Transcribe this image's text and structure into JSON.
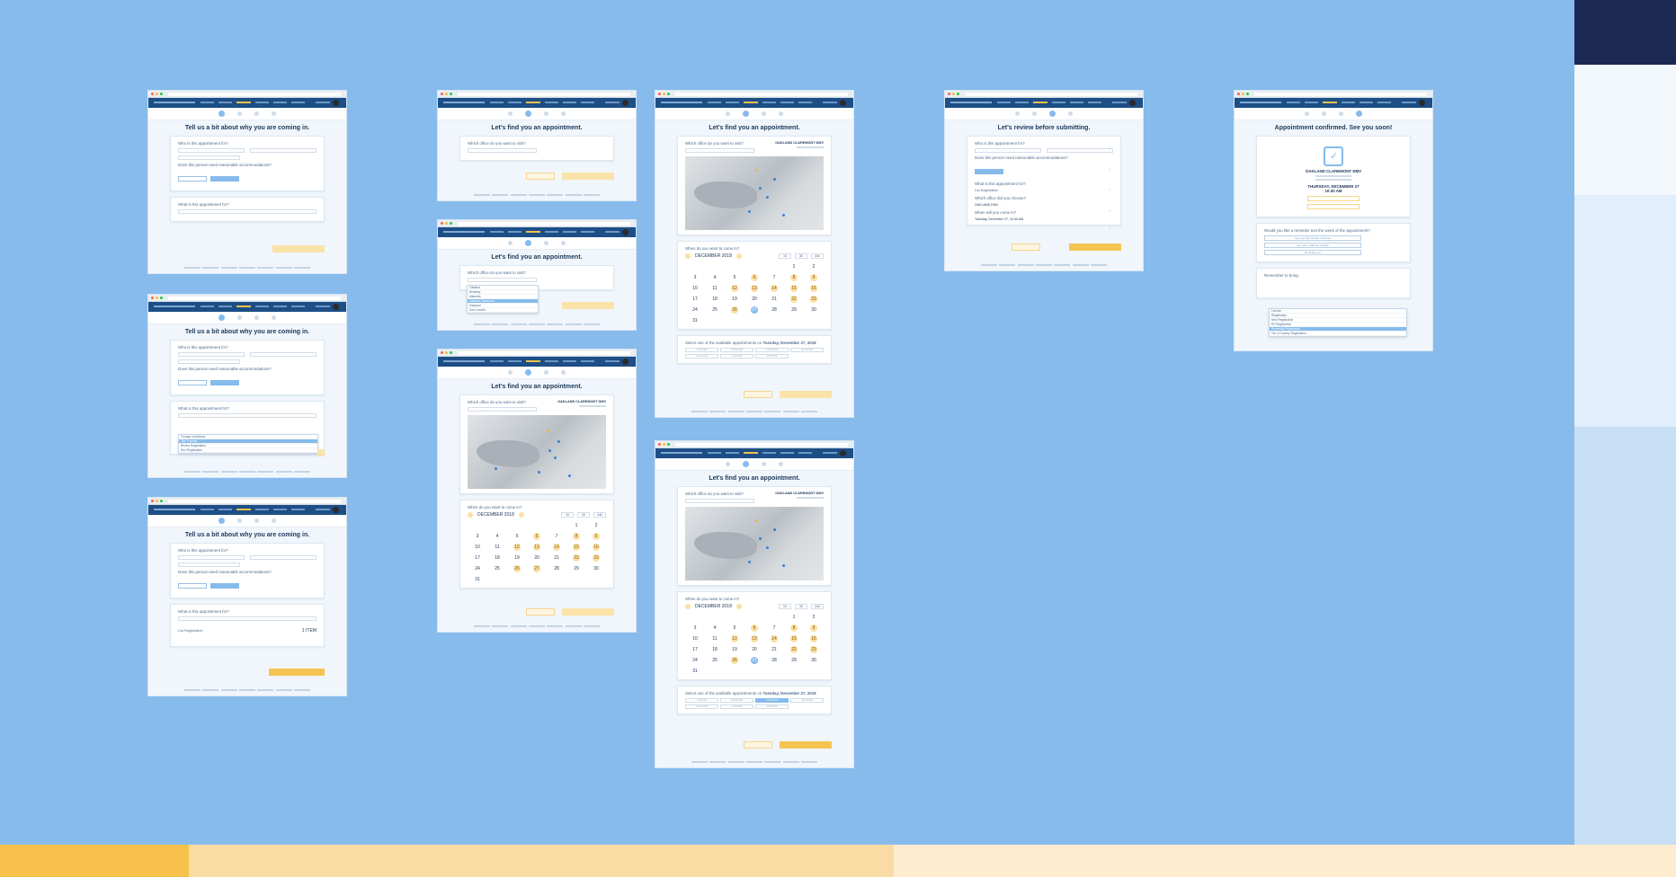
{
  "colors": {
    "background": "#86bbec",
    "nav": "#1d4e86",
    "accent_yellow": "#f6c452",
    "accent_blue": "#86bbec",
    "band_left": "#f8c14c",
    "band_mid": "#f9dca4",
    "band_right": "#fdecd0",
    "side_dark": "#1c2a53"
  },
  "screens": {
    "reason": {
      "title": "Tell us a bit about why you are coming in.",
      "who_label": "Who is this appointment for?",
      "accommodations_label": "Does this person need reasonable accommodations?",
      "yes_label": "Yes",
      "no_label": "No",
      "what_label": "What is this appointment for?",
      "reason_options": [
        "Change of Address",
        "Title Transfer",
        "Renew Registration",
        "Non-Registration"
      ],
      "item_label": "Car Registration",
      "item_count": "1 ITEM"
    },
    "find": {
      "title": "Let's find you an appointment.",
      "office_label": "Which office do you want to visit?",
      "office_name": "OAKLAND CLAREMONT DMV",
      "office_options": [
        "Oakland",
        "Berkeley",
        "Alameda",
        "Oakland Claremont",
        "Hayward",
        "San Leandro"
      ],
      "when_label": "When do you want to come in?",
      "month": "DECEMBER 2018",
      "hour": "10",
      "minute": "30",
      "ampm": "AM",
      "calendar_days": [
        "",
        "",
        "",
        "",
        "",
        "1",
        "2",
        "3",
        "4",
        "5",
        "6",
        "7",
        "8",
        "9",
        "10",
        "11",
        "12",
        "13",
        "14",
        "15",
        "16",
        "17",
        "18",
        "19",
        "20",
        "21",
        "22",
        "23",
        "24",
        "25",
        "26",
        "27",
        "28",
        "29",
        "30",
        "31"
      ],
      "highlighted_days": [
        "6",
        "8",
        "9",
        "12",
        "13",
        "14",
        "15",
        "16",
        "22",
        "23",
        "26",
        "27"
      ],
      "selected_day": "27",
      "slots_label": "Select one of the available appointments on",
      "slots_date": "Tuesday, December 27, 2018",
      "slots": [
        "9:15 AM",
        "10:00 AM",
        "10:30 AM",
        "11:45 AM",
        "12:30 PM",
        "1:30 PM",
        "2:00 PM"
      ],
      "selected_slot": "10:30 AM"
    },
    "review": {
      "title": "Let's review before submitting.",
      "who_label": "Who is this appointment for?",
      "accommodations_label": "Does this person need reasonable accommodations?",
      "what_label": "What is this appointment for?",
      "item_label": "Car Registration",
      "office_label": "Which office did you choose?",
      "office_name": "OAKLAND DMV",
      "when_label": "When will you come in?",
      "when_value": "Tuesday, December 27, 10:30 AM"
    },
    "confirm": {
      "title": "Appointment confirmed. See you soon!",
      "office_name": "OAKLAND CLAREMONT DMV",
      "date": "THURSDAY, DECEMBER 27",
      "time": "10:30 AM",
      "reminder_label": "Would you like a reminder text the week of the appointment?",
      "reminder_options": [
        "Yes, use the number I entered",
        "Yes, use a different number",
        "No thank you"
      ],
      "remember_label": "Remember to bring:",
      "bring_options": [
        "License",
        "Registration",
        "New Registration",
        "RV Registration",
        "Renewing Registration",
        "Out of Country Registration"
      ]
    }
  }
}
